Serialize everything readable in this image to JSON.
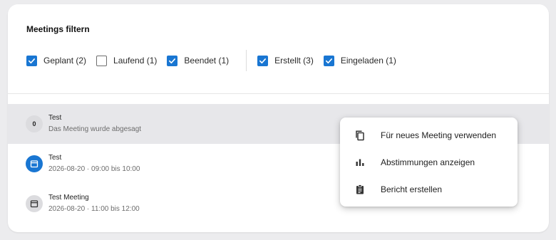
{
  "filter": {
    "title": "Meetings filtern",
    "status_options": [
      {
        "label": "Geplant (2)",
        "checked": true
      },
      {
        "label": "Laufend (1)",
        "checked": false
      },
      {
        "label": "Beendet (1)",
        "checked": true
      }
    ],
    "role_options": [
      {
        "label": "Erstellt (3)",
        "checked": true
      },
      {
        "label": "Eingeladen (1)",
        "checked": true
      }
    ]
  },
  "meetings": [
    {
      "avatar_text": "0",
      "title": "Test",
      "subtitle": "Das Meeting wurde abgesagt",
      "selected": true
    },
    {
      "avatar_icon": "calendar-icon",
      "title": "Test",
      "subtitle": "2026-08-20 · 09:00 bis 10:00",
      "selected": false
    },
    {
      "avatar_icon": "calendar-icon",
      "title": "Test Meeting",
      "subtitle": "2026-08-20 · 11:00 bis 12:00",
      "selected": false
    }
  ],
  "context_menu": {
    "items": [
      {
        "label": "Für neues Meeting verwenden",
        "icon": "copy-icon"
      },
      {
        "label": "Abstimmungen anzeigen",
        "icon": "bar-chart-icon"
      },
      {
        "label": "Bericht erstellen",
        "icon": "clipboard-icon"
      }
    ]
  },
  "colors": {
    "accent": "#1976d2",
    "background": "#ececee",
    "selected_row": "#e7e7ea"
  }
}
